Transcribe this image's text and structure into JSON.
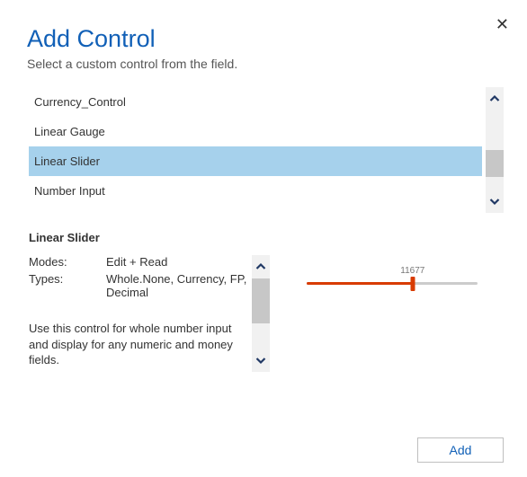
{
  "dialog": {
    "title": "Add Control",
    "subtitle": "Select a custom control from the field.",
    "close_label": "✕"
  },
  "list": {
    "items": [
      {
        "label": "Currency_Control",
        "selected": false
      },
      {
        "label": "Linear Gauge",
        "selected": false
      },
      {
        "label": "Linear Slider",
        "selected": true
      },
      {
        "label": "Number Input",
        "selected": false
      }
    ]
  },
  "detail": {
    "heading": "Linear Slider",
    "modes_label": "Modes:",
    "modes_value": "Edit + Read",
    "types_label": "Types:",
    "types_value": "Whole.None, Currency, FP, Decimal",
    "description": "Use this control for whole number input and display for any numeric and money fields."
  },
  "preview": {
    "slider_value": "11677"
  },
  "footer": {
    "add_label": "Add"
  }
}
